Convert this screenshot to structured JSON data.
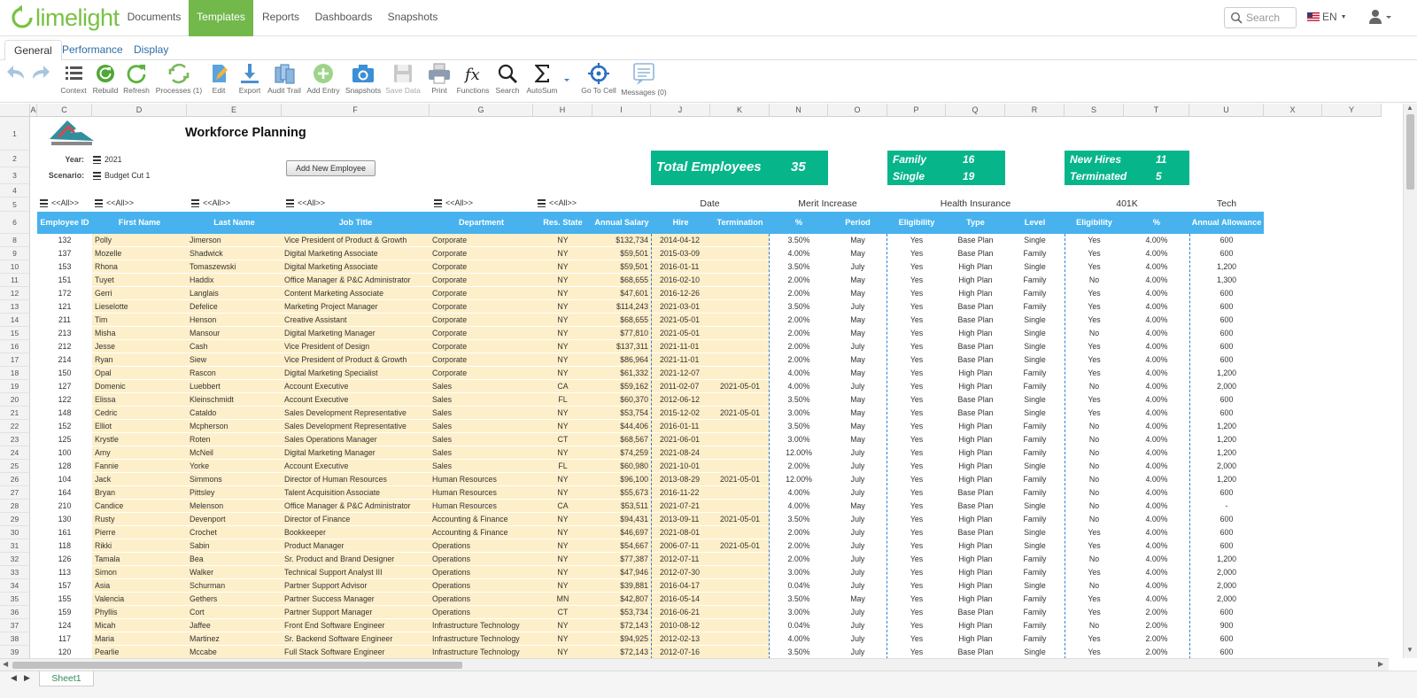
{
  "app": {
    "logo_text": "limelight",
    "brand_color": "#72b84b"
  },
  "nav": [
    "Documents",
    "Templates",
    "Reports",
    "Dashboards",
    "Snapshots"
  ],
  "nav_active": "Templates",
  "search": {
    "placeholder": "Search"
  },
  "lang": "EN",
  "subtabs": [
    "General",
    "Performance",
    "Display"
  ],
  "toolbar": [
    {
      "label": "",
      "icon": "undo-icon"
    },
    {
      "label": "",
      "icon": "redo-icon"
    },
    {
      "label": "Context",
      "icon": "list-icon"
    },
    {
      "label": "Rebuild",
      "icon": "rebuild-icon"
    },
    {
      "label": "Refresh",
      "icon": "refresh-icon"
    },
    {
      "label": "Processes (1)",
      "icon": "processes-icon"
    },
    {
      "label": "Edit",
      "icon": "edit-icon"
    },
    {
      "label": "Export",
      "icon": "export-icon"
    },
    {
      "label": "Audit Trail",
      "icon": "audit-trail-icon"
    },
    {
      "label": "Add Entry",
      "icon": "add-entry-icon"
    },
    {
      "label": "Snapshots",
      "icon": "camera-icon"
    },
    {
      "label": "Save Data",
      "icon": "save-icon"
    },
    {
      "label": "Print",
      "icon": "print-icon"
    },
    {
      "label": "Functions",
      "icon": "function-icon"
    },
    {
      "label": "Search",
      "icon": "search-icon"
    },
    {
      "label": "AutoSum",
      "icon": "sigma-icon"
    },
    {
      "label": "Go To Cell",
      "icon": "crosshair-icon"
    },
    {
      "label": "Messages (0)",
      "icon": "message-icon"
    }
  ],
  "columns": [
    "A",
    "C",
    "D",
    "E",
    "F",
    "G",
    "H",
    "I",
    "J",
    "K",
    "N",
    "O",
    "P",
    "Q",
    "R",
    "S",
    "T",
    "U",
    "X",
    "Y"
  ],
  "sheet": {
    "title": "Workforce Planning",
    "year_label": "Year:",
    "year": "2021",
    "scenario_label": "Scenario:",
    "scenario": "Budget Cut 1",
    "add_button": "Add New Employee",
    "total_label": "Total Employees",
    "total": "35",
    "family_label": "Family",
    "family": "16",
    "single_label": "Single",
    "single": "19",
    "newhires_label": "New Hires",
    "newhires": "11",
    "terminated_label": "Terminated",
    "terminated": "5",
    "filter_all": "<<All>>",
    "group_headers": {
      "date": "Date",
      "merit": "Merit Increase",
      "health": "Health Insurance",
      "k401": "401K",
      "tech": "Tech"
    },
    "headers": [
      "Employee ID",
      "First Name",
      "Last Name",
      "Job Title",
      "Department",
      "Res. State",
      "Annual Salary",
      "Hire",
      "Termination",
      "%",
      "Period",
      "Eligibility",
      "Type",
      "Level",
      "Eligibility",
      "%",
      "Annual Allowance"
    ]
  },
  "rows": [
    [
      "132",
      "Polly",
      "Jimerson",
      "Vice President of Product & Growth",
      "Corporate",
      "NY",
      "$132,734",
      "2014-04-12",
      "",
      "3.50%",
      "May",
      "Yes",
      "Base Plan",
      "Single",
      "Yes",
      "4.00%",
      "600"
    ],
    [
      "137",
      "Mozelle",
      "Shadwick",
      "Digital Marketing Associate",
      "Corporate",
      "NY",
      "$59,501",
      "2015-03-09",
      "",
      "4.00%",
      "May",
      "Yes",
      "Base Plan",
      "Family",
      "Yes",
      "4.00%",
      "600"
    ],
    [
      "153",
      "Rhona",
      "Tomaszewski",
      "Digital Marketing Associate",
      "Corporate",
      "NY",
      "$59,501",
      "2016-01-11",
      "",
      "3.50%",
      "July",
      "Yes",
      "High Plan",
      "Single",
      "Yes",
      "4.00%",
      "1,200"
    ],
    [
      "151",
      "Tuyet",
      "Haddix",
      "Office Manager & P&C Administrator",
      "Corporate",
      "NY",
      "$68,655",
      "2016-02-10",
      "",
      "2.00%",
      "May",
      "Yes",
      "High Plan",
      "Family",
      "No",
      "4.00%",
      "1,300"
    ],
    [
      "172",
      "Gerri",
      "Langlais",
      "Content Marketing Associate",
      "Corporate",
      "NY",
      "$47,601",
      "2016-12-26",
      "",
      "2.00%",
      "May",
      "Yes",
      "High Plan",
      "Family",
      "Yes",
      "4.00%",
      "600"
    ],
    [
      "121",
      "Lieselotte",
      "Defelice",
      "Marketing Project Manager",
      "Corporate",
      "NY",
      "$114,243",
      "2021-03-01",
      "",
      "3.50%",
      "July",
      "Yes",
      "Base Plan",
      "Family",
      "Yes",
      "4.00%",
      "600"
    ],
    [
      "211",
      "Tim",
      "Henson",
      "Creative Assistant",
      "Corporate",
      "NY",
      "$68,655",
      "2021-05-01",
      "",
      "2.00%",
      "May",
      "Yes",
      "Base Plan",
      "Single",
      "Yes",
      "4.00%",
      "600"
    ],
    [
      "213",
      "Misha",
      "Mansour",
      "Digital Marketing Manager",
      "Corporate",
      "NY",
      "$77,810",
      "2021-05-01",
      "",
      "2.00%",
      "May",
      "Yes",
      "High Plan",
      "Single",
      "No",
      "4.00%",
      "600"
    ],
    [
      "212",
      "Jesse",
      "Cash",
      "Vice President of Design",
      "Corporate",
      "NY",
      "$137,311",
      "2021-11-01",
      "",
      "2.00%",
      "July",
      "Yes",
      "Base Plan",
      "Single",
      "Yes",
      "4.00%",
      "600"
    ],
    [
      "214",
      "Ryan",
      "Siew",
      "Vice President of Product & Growth",
      "Corporate",
      "NY",
      "$86,964",
      "2021-11-01",
      "",
      "2.00%",
      "May",
      "Yes",
      "Base Plan",
      "Single",
      "Yes",
      "4.00%",
      "600"
    ],
    [
      "150",
      "Opal",
      "Rascon",
      "Digital Marketing Specialist",
      "Corporate",
      "NY",
      "$61,332",
      "2021-12-07",
      "",
      "4.00%",
      "May",
      "Yes",
      "High Plan",
      "Family",
      "Yes",
      "4.00%",
      "1,200"
    ],
    [
      "127",
      "Domenic",
      "Luebbert",
      "Account Executive",
      "Sales",
      "CA",
      "$59,162",
      "2011-02-07",
      "2021-05-01",
      "4.00%",
      "July",
      "Yes",
      "High Plan",
      "Family",
      "No",
      "4.00%",
      "2,000"
    ],
    [
      "122",
      "Elissa",
      "Kleinschmidt",
      "Account Executive",
      "Sales",
      "FL",
      "$60,370",
      "2012-06-12",
      "",
      "3.50%",
      "May",
      "Yes",
      "Base Plan",
      "Single",
      "Yes",
      "4.00%",
      "600"
    ],
    [
      "148",
      "Cedric",
      "Cataldo",
      "Sales Development Representative",
      "Sales",
      "NY",
      "$53,754",
      "2015-12-02",
      "2021-05-01",
      "3.00%",
      "May",
      "Yes",
      "Base Plan",
      "Single",
      "Yes",
      "4.00%",
      "600"
    ],
    [
      "152",
      "Elliot",
      "Mcpherson",
      "Sales Development Representative",
      "Sales",
      "NY",
      "$44,406",
      "2016-01-11",
      "",
      "3.50%",
      "May",
      "Yes",
      "High Plan",
      "Family",
      "No",
      "4.00%",
      "1,200"
    ],
    [
      "125",
      "Krystle",
      "Roten",
      "Sales Operations Manager",
      "Sales",
      "CT",
      "$68,567",
      "2021-06-01",
      "",
      "3.00%",
      "May",
      "Yes",
      "High Plan",
      "Family",
      "No",
      "4.00%",
      "1,200"
    ],
    [
      "100",
      "Amy",
      "McNeil",
      "Digital Marketing Manager",
      "Sales",
      "NY",
      "$74,259",
      "2021-08-24",
      "",
      "12.00%",
      "July",
      "Yes",
      "High Plan",
      "Family",
      "No",
      "4.00%",
      "1,200"
    ],
    [
      "128",
      "Fannie",
      "Yorke",
      "Account Executive",
      "Sales",
      "FL",
      "$60,980",
      "2021-10-01",
      "",
      "2.00%",
      "July",
      "Yes",
      "High Plan",
      "Single",
      "No",
      "4.00%",
      "2,000"
    ],
    [
      "104",
      "Jack",
      "Simmons",
      "Director of Human Resources",
      "Human Resources",
      "NY",
      "$96,100",
      "2013-08-29",
      "2021-05-01",
      "12.00%",
      "July",
      "Yes",
      "High Plan",
      "Family",
      "No",
      "4.00%",
      "1,200"
    ],
    [
      "164",
      "Bryan",
      "Pittsley",
      "Talent Acquisition Associate",
      "Human Resources",
      "NY",
      "$55,673",
      "2016-11-22",
      "",
      "4.00%",
      "July",
      "Yes",
      "Base Plan",
      "Family",
      "No",
      "4.00%",
      "600"
    ],
    [
      "210",
      "Candice",
      "Melenson",
      "Office Manager & P&C Administrator",
      "Human Resources",
      "CA",
      "$53,511",
      "2021-07-21",
      "",
      "4.00%",
      "May",
      "Yes",
      "Base Plan",
      "Single",
      "No",
      "4.00%",
      "-"
    ],
    [
      "130",
      "Rusty",
      "Devenport",
      "Director of Finance",
      "Accounting & Finance",
      "NY",
      "$94,431",
      "2013-09-11",
      "2021-05-01",
      "3.50%",
      "July",
      "Yes",
      "High Plan",
      "Family",
      "No",
      "4.00%",
      "600"
    ],
    [
      "161",
      "Pierre",
      "Crochet",
      "Bookkeeper",
      "Accounting & Finance",
      "NY",
      "$46,697",
      "2021-08-01",
      "",
      "2.00%",
      "July",
      "Yes",
      "Base Plan",
      "Single",
      "Yes",
      "4.00%",
      "600"
    ],
    [
      "118",
      "Rikki",
      "Sabin",
      "Product Manager",
      "Operations",
      "NY",
      "$54,667",
      "2006-07-11",
      "2021-05-01",
      "2.00%",
      "July",
      "Yes",
      "High Plan",
      "Single",
      "Yes",
      "4.00%",
      "600"
    ],
    [
      "126",
      "Tamala",
      "Bea",
      "Sr. Product and Brand Designer",
      "Operations",
      "NY",
      "$77,387",
      "2012-07-11",
      "",
      "2.00%",
      "July",
      "Yes",
      "High Plan",
      "Family",
      "No",
      "4.00%",
      "1,200"
    ],
    [
      "113",
      "Simon",
      "Walker",
      "Technical Support Analyst III",
      "Operations",
      "NY",
      "$47,946",
      "2012-07-30",
      "",
      "3.00%",
      "July",
      "Yes",
      "High Plan",
      "Family",
      "Yes",
      "4.00%",
      "2,000"
    ],
    [
      "157",
      "Asia",
      "Schurman",
      "Partner Support Advisor",
      "Operations",
      "NY",
      "$39,881",
      "2016-04-17",
      "",
      "0.04%",
      "July",
      "Yes",
      "High Plan",
      "Single",
      "No",
      "4.00%",
      "2,000"
    ],
    [
      "155",
      "Valencia",
      "Gethers",
      "Partner Success Manager",
      "Operations",
      "MN",
      "$42,807",
      "2016-05-14",
      "",
      "3.50%",
      "May",
      "Yes",
      "High Plan",
      "Family",
      "Yes",
      "4.00%",
      "2,000"
    ],
    [
      "159",
      "Phyllis",
      "Cort",
      "Partner Support Manager",
      "Operations",
      "CT",
      "$53,734",
      "2016-06-21",
      "",
      "3.00%",
      "July",
      "Yes",
      "Base Plan",
      "Family",
      "Yes",
      "2.00%",
      "600"
    ],
    [
      "124",
      "Micah",
      "Jaffee",
      "Front End Software Engineer",
      "Infrastructure Technology",
      "NY",
      "$72,143",
      "2010-08-12",
      "",
      "0.04%",
      "July",
      "Yes",
      "High Plan",
      "Family",
      "No",
      "2.00%",
      "900"
    ],
    [
      "117",
      "Maria",
      "Martinez",
      "Sr. Backend Software Engineer",
      "Infrastructure Technology",
      "NY",
      "$94,925",
      "2012-02-13",
      "",
      "4.00%",
      "July",
      "Yes",
      "High Plan",
      "Family",
      "Yes",
      "2.00%",
      "600"
    ],
    [
      "120",
      "Pearlie",
      "Mccabe",
      "Full Stack Software Engineer",
      "Infrastructure Technology",
      "NY",
      "$72,143",
      "2012-07-16",
      "",
      "3.50%",
      "July",
      "Yes",
      "Base Plan",
      "Single",
      "Yes",
      "2.00%",
      "600"
    ]
  ],
  "row_numbers": [
    "1",
    "2",
    "3",
    "4",
    "5",
    "6",
    "8",
    "9",
    "10",
    "11",
    "12",
    "13",
    "14",
    "15",
    "16",
    "17",
    "18",
    "19",
    "20",
    "21",
    "22",
    "23",
    "24",
    "25",
    "26",
    "27",
    "28",
    "29",
    "30",
    "31",
    "32",
    "33",
    "34",
    "35",
    "36",
    "37",
    "38",
    "39"
  ],
  "sheet_tab": "Sheet1",
  "colors": {
    "header_blue": "#47b2ee",
    "kpi_green": "#07b58b",
    "input_yellow": "#fdefc9"
  }
}
